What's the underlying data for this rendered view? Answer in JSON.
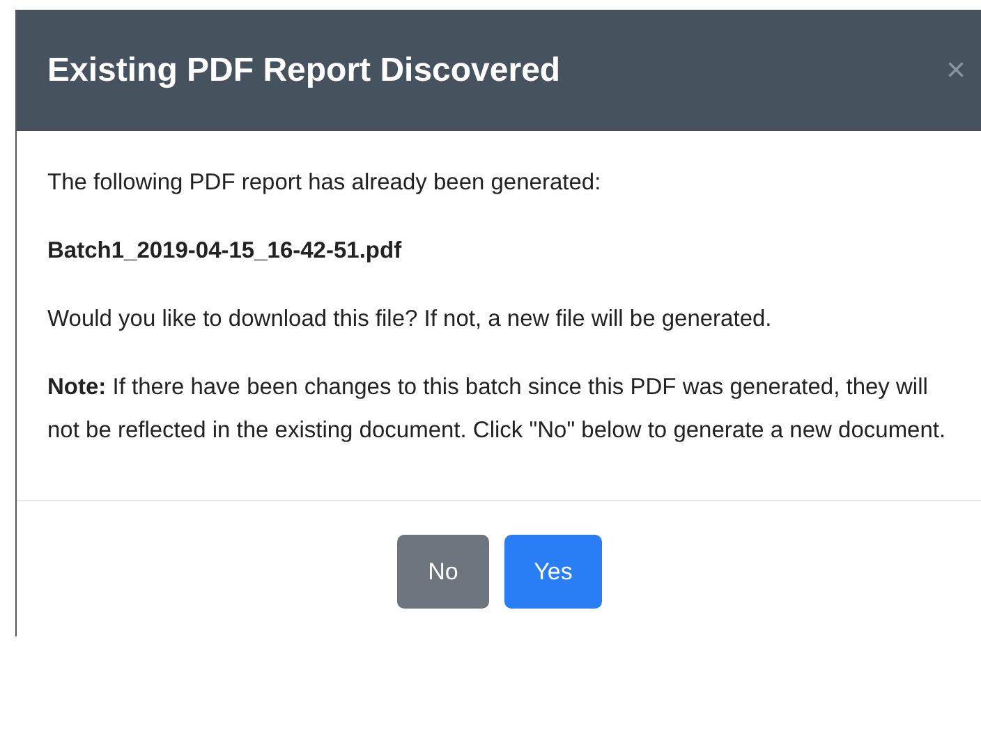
{
  "dialog": {
    "title": "Existing PDF Report Discovered",
    "close": "×",
    "body": [
      {
        "kind": "text",
        "text": "The following PDF report has already been generated:"
      },
      {
        "kind": "filename",
        "text": "Batch1_2019-04-15_16-42-51.pdf"
      },
      {
        "kind": "text",
        "text": "Would you like to download this file? If not, a new file will be generated."
      },
      {
        "kind": "text",
        "text": "**Note:** If there have been changes to this batch since this PDF was generated, they will not be reflected in the existing document. Click \"No\" below to generate a new document."
      }
    ],
    "buttons": [
      {
        "label": "No",
        "kind": "secondary"
      },
      {
        "label": "Yes",
        "kind": "primary"
      }
    ]
  }
}
